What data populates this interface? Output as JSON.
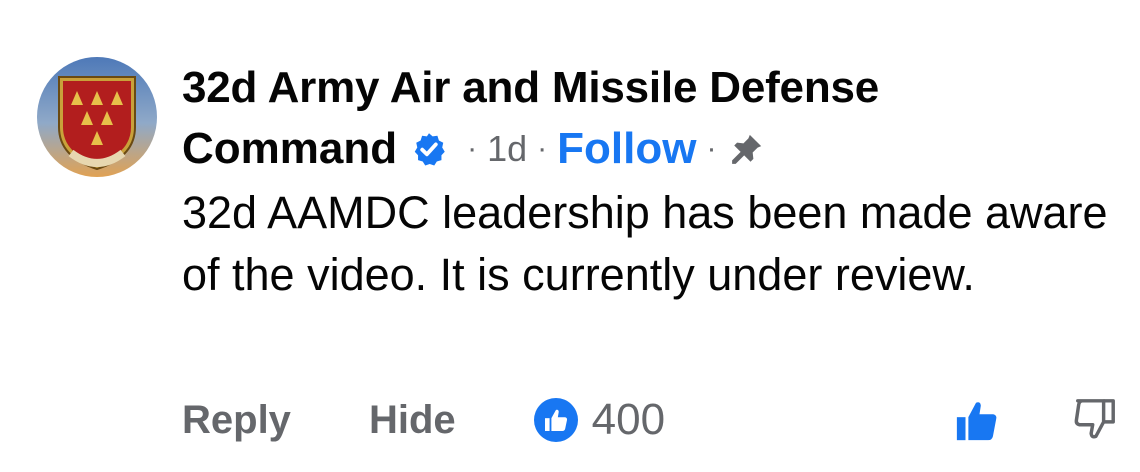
{
  "comment": {
    "author_line1": "32d Army Air and Missile Defense",
    "author_line2": "Command",
    "time": "1d",
    "follow_label": "Follow",
    "body": "32d AAMDC leadership has been made aware of the video. It is currently under review.",
    "reply_label": "Reply",
    "hide_label": "Hide",
    "reaction_count": "400"
  },
  "icons": {
    "verified": "verified-badge-icon",
    "pin": "pin-icon",
    "reaction": "thumbs-up-reaction-icon",
    "like": "thumbs-up-icon",
    "dislike": "thumbs-down-icon"
  },
  "colors": {
    "accent": "#1877f2",
    "secondary_text": "#65676b",
    "primary_text": "#050505"
  }
}
